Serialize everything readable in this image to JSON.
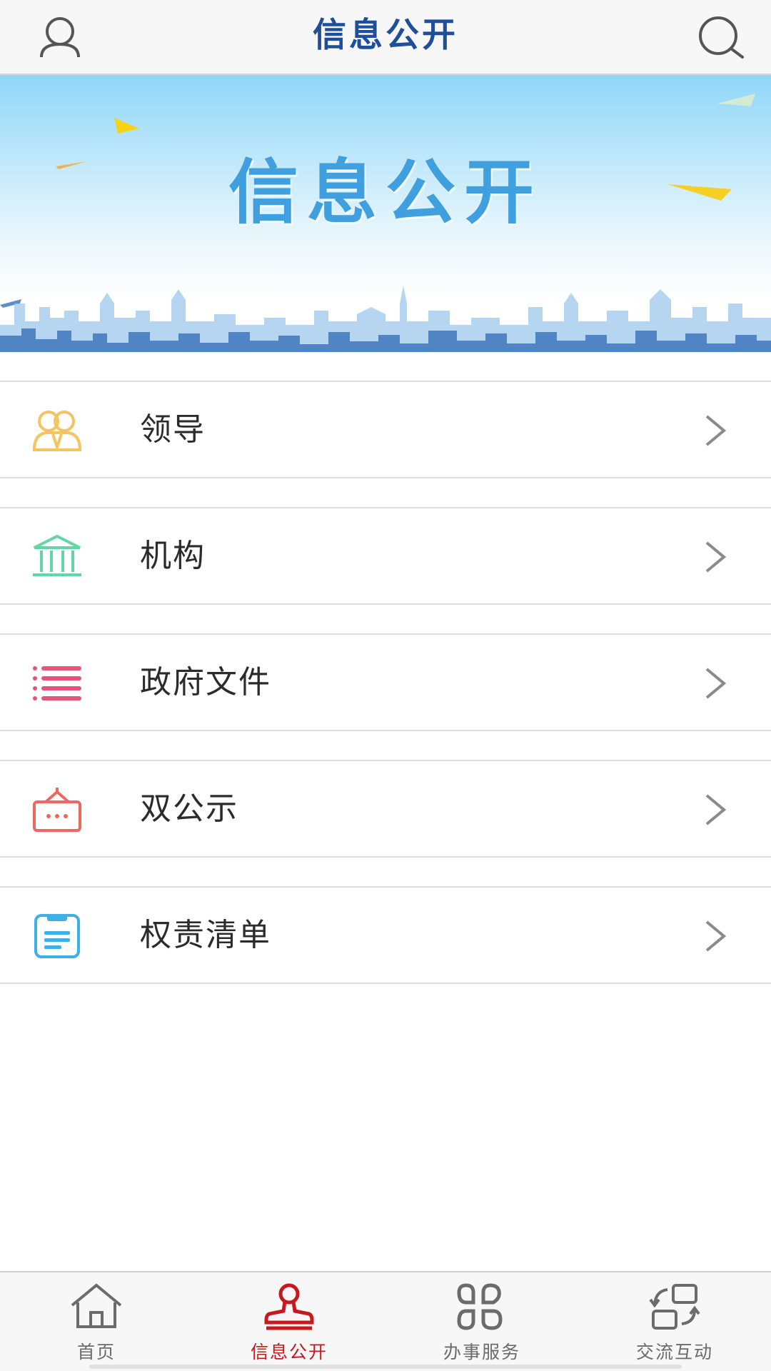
{
  "header": {
    "title": "信息公开",
    "user_icon": "user-icon",
    "search_icon": "search-icon"
  },
  "banner": {
    "title": "信息公开"
  },
  "menu": {
    "items": [
      {
        "label": "领导",
        "icon": "leaders-icon",
        "color": "#f5c462"
      },
      {
        "label": "机构",
        "icon": "institution-icon",
        "color": "#63d6a6"
      },
      {
        "label": "政府文件",
        "icon": "list-icon",
        "color": "#e5547a"
      },
      {
        "label": "双公示",
        "icon": "notice-board-icon",
        "color": "#ec6860"
      },
      {
        "label": "权责清单",
        "icon": "clipboard-icon",
        "color": "#3db0e8"
      }
    ]
  },
  "tabbar": {
    "active_color": "#c9171e",
    "items": [
      {
        "label": "首页",
        "icon": "home-icon",
        "active": false
      },
      {
        "label": "信息公开",
        "icon": "stamp-icon",
        "active": true
      },
      {
        "label": "办事服务",
        "icon": "apps-icon",
        "active": false
      },
      {
        "label": "交流互动",
        "icon": "exchange-icon",
        "active": false
      }
    ]
  }
}
